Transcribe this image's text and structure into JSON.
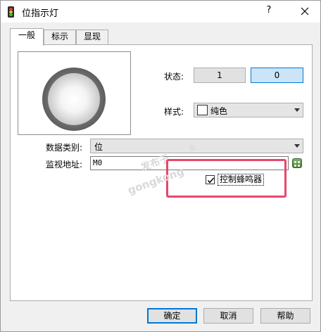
{
  "window": {
    "title": "位指示灯",
    "help": "?"
  },
  "tabs": [
    {
      "label": "一般",
      "active": true
    },
    {
      "label": "标示",
      "active": false
    },
    {
      "label": "显现",
      "active": false
    }
  ],
  "general": {
    "state_label": "状态:",
    "state_buttons": [
      "1",
      "0"
    ],
    "selected_state": "0",
    "style_label": "样式:",
    "style_value": "纯色",
    "data_type_label": "数据类别:",
    "data_type_value": "位",
    "monitor_addr_label": "监视地址:",
    "monitor_addr_value": "M0",
    "buzzer_label": "控制蜂鸣器",
    "buzzer_checked": true
  },
  "watermark": {
    "line1": "发布于",
    "line2": "gongkong",
    "mark": "®"
  },
  "footer": {
    "ok": "确定",
    "cancel": "取消",
    "help": "帮助"
  },
  "colors": {
    "accent": "#0078d7",
    "highlight": "#e8476a"
  }
}
